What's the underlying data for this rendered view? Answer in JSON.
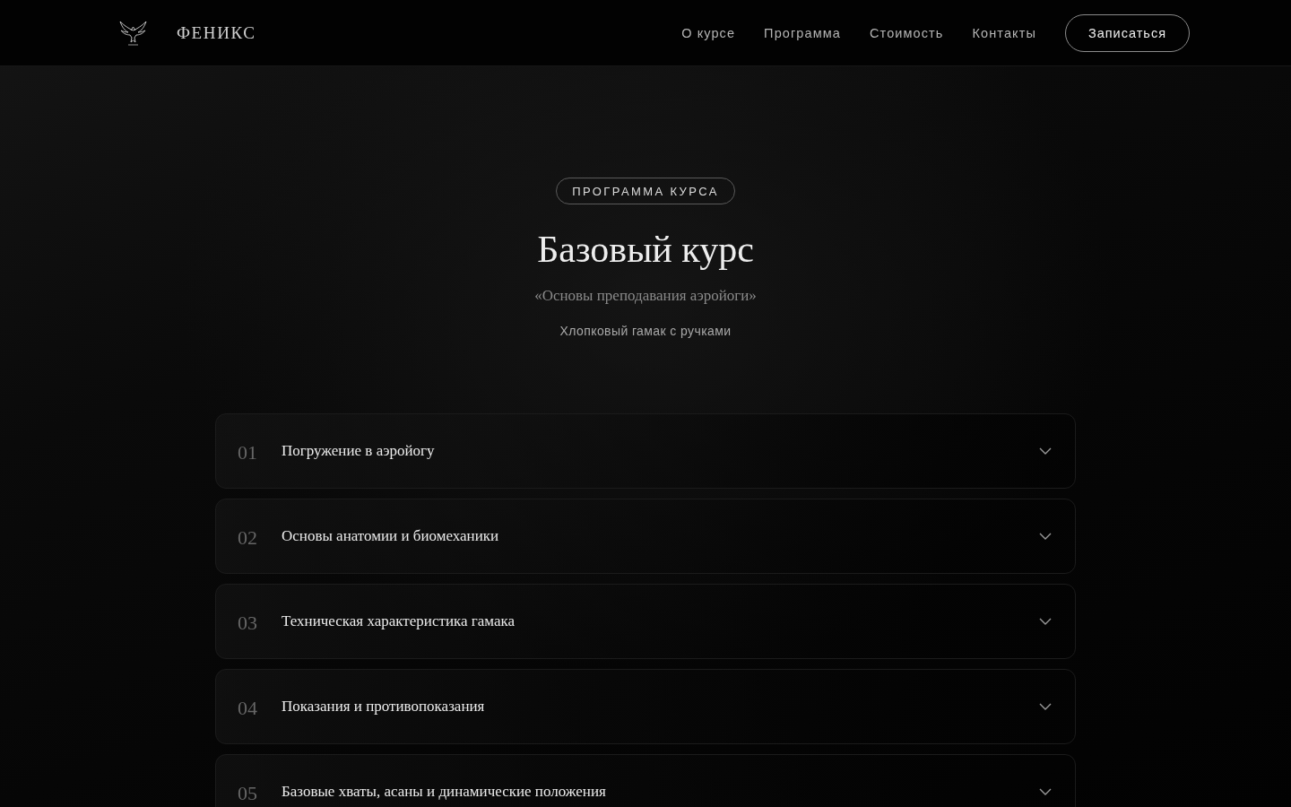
{
  "header": {
    "brand": "ФЕНИКС",
    "nav": [
      "О курсе",
      "Программа",
      "Стоимость",
      "Контакты"
    ],
    "cta": "Записаться"
  },
  "hero": {
    "badge": "ПРОГРАММА КУРСА",
    "title": "Базовый курс",
    "subtitle": "«Основы преподавания аэройоги»",
    "note": "Хлопковый гамак с ручками"
  },
  "modules": [
    {
      "number": "01",
      "title": "Погружение в аэройогу",
      "expanded": false
    },
    {
      "number": "02",
      "title": "Основы анатомии и биомеханики",
      "expanded": false
    },
    {
      "number": "03",
      "title": "Техническая характеристика гамака",
      "expanded": false
    },
    {
      "number": "04",
      "title": "Показания и противопоказания",
      "expanded": false
    },
    {
      "number": "05",
      "title": "Базовые хваты, асаны и динамические положения",
      "expanded": false
    }
  ]
}
